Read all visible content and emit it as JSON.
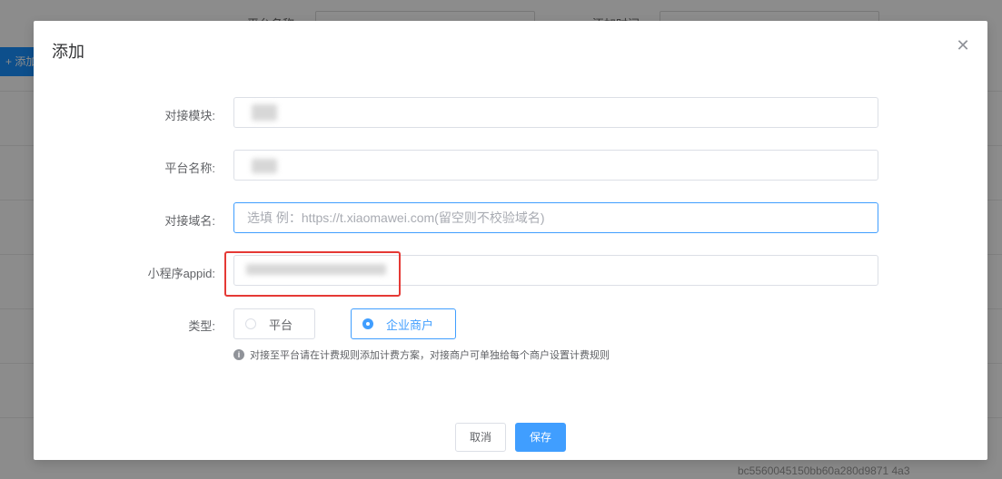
{
  "background": {
    "add_button_label": "+ 添加",
    "header_col_1": "平台名称",
    "header_col_2": "添加时间",
    "footer_snippet": "bc5560045150bb60a280d9871 4a3"
  },
  "dialog": {
    "title": "添加",
    "close_icon": "close-icon",
    "fields": {
      "module": {
        "label": "对接模块:",
        "value": ""
      },
      "platform_name": {
        "label": "平台名称:",
        "value": ""
      },
      "domain": {
        "label": "对接域名:",
        "placeholder": "选填 例：https://t.xiaomawei.com(留空则不校验域名)",
        "value": ""
      },
      "appid": {
        "label": "小程序appid:",
        "value": ""
      }
    },
    "type": {
      "label": "类型:",
      "options": [
        {
          "label": "平台",
          "checked": false
        },
        {
          "label": "企业商户",
          "checked": true
        }
      ],
      "hint": "对接至平台请在计费规则添加计费方案，对接商户可单独给每个商户设置计费规则"
    },
    "buttons": {
      "cancel": "取消",
      "save": "保存"
    }
  },
  "colors": {
    "primary": "#409eff",
    "highlight": "#e53935"
  }
}
